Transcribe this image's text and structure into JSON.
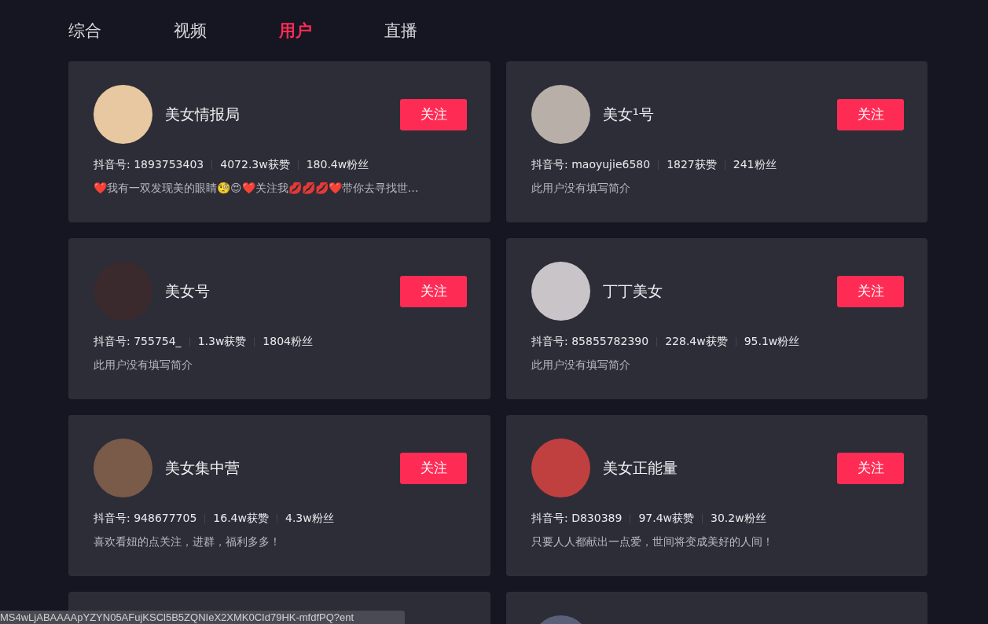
{
  "tabs": [
    {
      "label": "综合",
      "selected": false
    },
    {
      "label": "视频",
      "selected": false
    },
    {
      "label": "用户",
      "selected": true
    },
    {
      "label": "直播",
      "selected": false
    }
  ],
  "users": [
    {
      "name": "美女情报局",
      "follow_button": "关注",
      "douyin_id": "抖音号: 1893753403",
      "likes": "4072.3w获赞",
      "fans": "180.4w粉丝",
      "bio": "❤️我有一双发现美的眼睛🧐😍❤️关注我💋💋💋❤️带你去寻找世…"
    },
    {
      "name": "美女¹号",
      "follow_button": "关注",
      "douyin_id": "抖音号: maoyujie6580",
      "likes": "1827获赞",
      "fans": "241粉丝",
      "bio": "此用户没有填写简介"
    },
    {
      "name": "美女号",
      "follow_button": "关注",
      "douyin_id": "抖音号: 755754_",
      "likes": "1.3w获赞",
      "fans": "1804粉丝",
      "bio": "此用户没有填写简介"
    },
    {
      "name": "丁丁美女",
      "follow_button": "关注",
      "douyin_id": "抖音号: 85855782390",
      "likes": "228.4w获赞",
      "fans": "95.1w粉丝",
      "bio": "此用户没有填写简介"
    },
    {
      "name": "美女集中营",
      "follow_button": "关注",
      "douyin_id": "抖音号: 948677705",
      "likes": "16.4w获赞",
      "fans": "4.3w粉丝",
      "bio": "喜欢看妞的点关注，进群，福利多多！"
    },
    {
      "name": "美女正能量",
      "follow_button": "关注",
      "douyin_id": "抖音号: D830389",
      "likes": "97.4w获赞",
      "fans": "30.2w粉丝",
      "bio": "只要人人都献出一点爱，世间将变成美好的人间！"
    }
  ],
  "status_url": "MS4wLjABAAAApYZYN05AFujKSCl5B5ZQNIeX2XMK0CId79HK-mfdfPQ?ent"
}
